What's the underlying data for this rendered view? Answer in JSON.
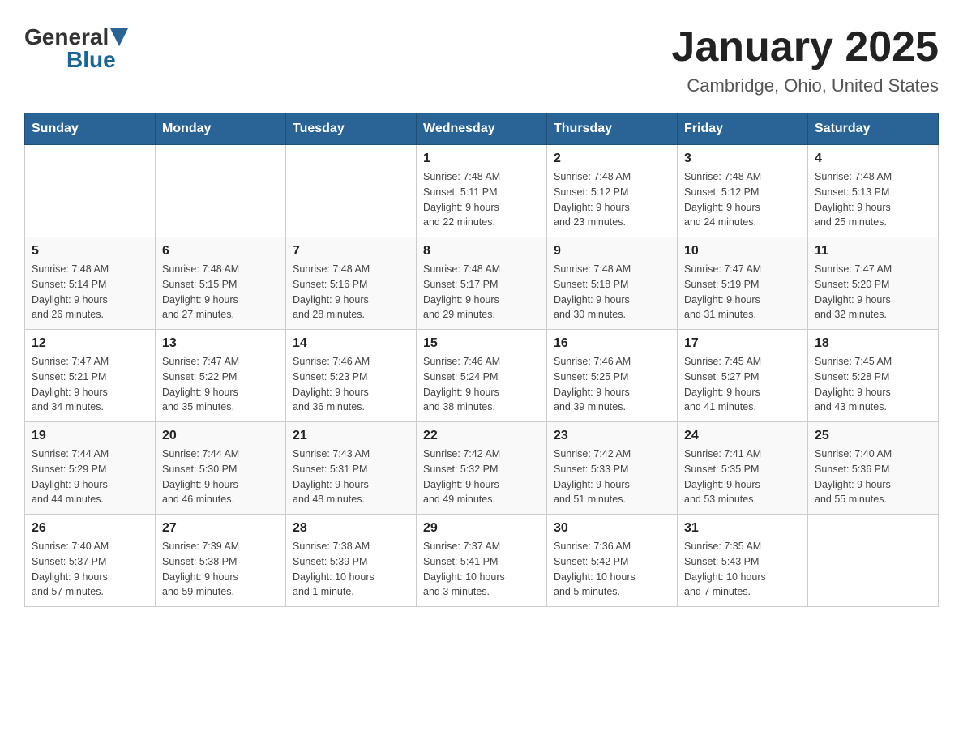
{
  "header": {
    "title": "January 2025",
    "subtitle": "Cambridge, Ohio, United States",
    "logo_general": "General",
    "logo_blue": "Blue"
  },
  "days_of_week": [
    "Sunday",
    "Monday",
    "Tuesday",
    "Wednesday",
    "Thursday",
    "Friday",
    "Saturday"
  ],
  "weeks": [
    [
      {
        "day": "",
        "info": ""
      },
      {
        "day": "",
        "info": ""
      },
      {
        "day": "",
        "info": ""
      },
      {
        "day": "1",
        "info": "Sunrise: 7:48 AM\nSunset: 5:11 PM\nDaylight: 9 hours\nand 22 minutes."
      },
      {
        "day": "2",
        "info": "Sunrise: 7:48 AM\nSunset: 5:12 PM\nDaylight: 9 hours\nand 23 minutes."
      },
      {
        "day": "3",
        "info": "Sunrise: 7:48 AM\nSunset: 5:12 PM\nDaylight: 9 hours\nand 24 minutes."
      },
      {
        "day": "4",
        "info": "Sunrise: 7:48 AM\nSunset: 5:13 PM\nDaylight: 9 hours\nand 25 minutes."
      }
    ],
    [
      {
        "day": "5",
        "info": "Sunrise: 7:48 AM\nSunset: 5:14 PM\nDaylight: 9 hours\nand 26 minutes."
      },
      {
        "day": "6",
        "info": "Sunrise: 7:48 AM\nSunset: 5:15 PM\nDaylight: 9 hours\nand 27 minutes."
      },
      {
        "day": "7",
        "info": "Sunrise: 7:48 AM\nSunset: 5:16 PM\nDaylight: 9 hours\nand 28 minutes."
      },
      {
        "day": "8",
        "info": "Sunrise: 7:48 AM\nSunset: 5:17 PM\nDaylight: 9 hours\nand 29 minutes."
      },
      {
        "day": "9",
        "info": "Sunrise: 7:48 AM\nSunset: 5:18 PM\nDaylight: 9 hours\nand 30 minutes."
      },
      {
        "day": "10",
        "info": "Sunrise: 7:47 AM\nSunset: 5:19 PM\nDaylight: 9 hours\nand 31 minutes."
      },
      {
        "day": "11",
        "info": "Sunrise: 7:47 AM\nSunset: 5:20 PM\nDaylight: 9 hours\nand 32 minutes."
      }
    ],
    [
      {
        "day": "12",
        "info": "Sunrise: 7:47 AM\nSunset: 5:21 PM\nDaylight: 9 hours\nand 34 minutes."
      },
      {
        "day": "13",
        "info": "Sunrise: 7:47 AM\nSunset: 5:22 PM\nDaylight: 9 hours\nand 35 minutes."
      },
      {
        "day": "14",
        "info": "Sunrise: 7:46 AM\nSunset: 5:23 PM\nDaylight: 9 hours\nand 36 minutes."
      },
      {
        "day": "15",
        "info": "Sunrise: 7:46 AM\nSunset: 5:24 PM\nDaylight: 9 hours\nand 38 minutes."
      },
      {
        "day": "16",
        "info": "Sunrise: 7:46 AM\nSunset: 5:25 PM\nDaylight: 9 hours\nand 39 minutes."
      },
      {
        "day": "17",
        "info": "Sunrise: 7:45 AM\nSunset: 5:27 PM\nDaylight: 9 hours\nand 41 minutes."
      },
      {
        "day": "18",
        "info": "Sunrise: 7:45 AM\nSunset: 5:28 PM\nDaylight: 9 hours\nand 43 minutes."
      }
    ],
    [
      {
        "day": "19",
        "info": "Sunrise: 7:44 AM\nSunset: 5:29 PM\nDaylight: 9 hours\nand 44 minutes."
      },
      {
        "day": "20",
        "info": "Sunrise: 7:44 AM\nSunset: 5:30 PM\nDaylight: 9 hours\nand 46 minutes."
      },
      {
        "day": "21",
        "info": "Sunrise: 7:43 AM\nSunset: 5:31 PM\nDaylight: 9 hours\nand 48 minutes."
      },
      {
        "day": "22",
        "info": "Sunrise: 7:42 AM\nSunset: 5:32 PM\nDaylight: 9 hours\nand 49 minutes."
      },
      {
        "day": "23",
        "info": "Sunrise: 7:42 AM\nSunset: 5:33 PM\nDaylight: 9 hours\nand 51 minutes."
      },
      {
        "day": "24",
        "info": "Sunrise: 7:41 AM\nSunset: 5:35 PM\nDaylight: 9 hours\nand 53 minutes."
      },
      {
        "day": "25",
        "info": "Sunrise: 7:40 AM\nSunset: 5:36 PM\nDaylight: 9 hours\nand 55 minutes."
      }
    ],
    [
      {
        "day": "26",
        "info": "Sunrise: 7:40 AM\nSunset: 5:37 PM\nDaylight: 9 hours\nand 57 minutes."
      },
      {
        "day": "27",
        "info": "Sunrise: 7:39 AM\nSunset: 5:38 PM\nDaylight: 9 hours\nand 59 minutes."
      },
      {
        "day": "28",
        "info": "Sunrise: 7:38 AM\nSunset: 5:39 PM\nDaylight: 10 hours\nand 1 minute."
      },
      {
        "day": "29",
        "info": "Sunrise: 7:37 AM\nSunset: 5:41 PM\nDaylight: 10 hours\nand 3 minutes."
      },
      {
        "day": "30",
        "info": "Sunrise: 7:36 AM\nSunset: 5:42 PM\nDaylight: 10 hours\nand 5 minutes."
      },
      {
        "day": "31",
        "info": "Sunrise: 7:35 AM\nSunset: 5:43 PM\nDaylight: 10 hours\nand 7 minutes."
      },
      {
        "day": "",
        "info": ""
      }
    ]
  ]
}
